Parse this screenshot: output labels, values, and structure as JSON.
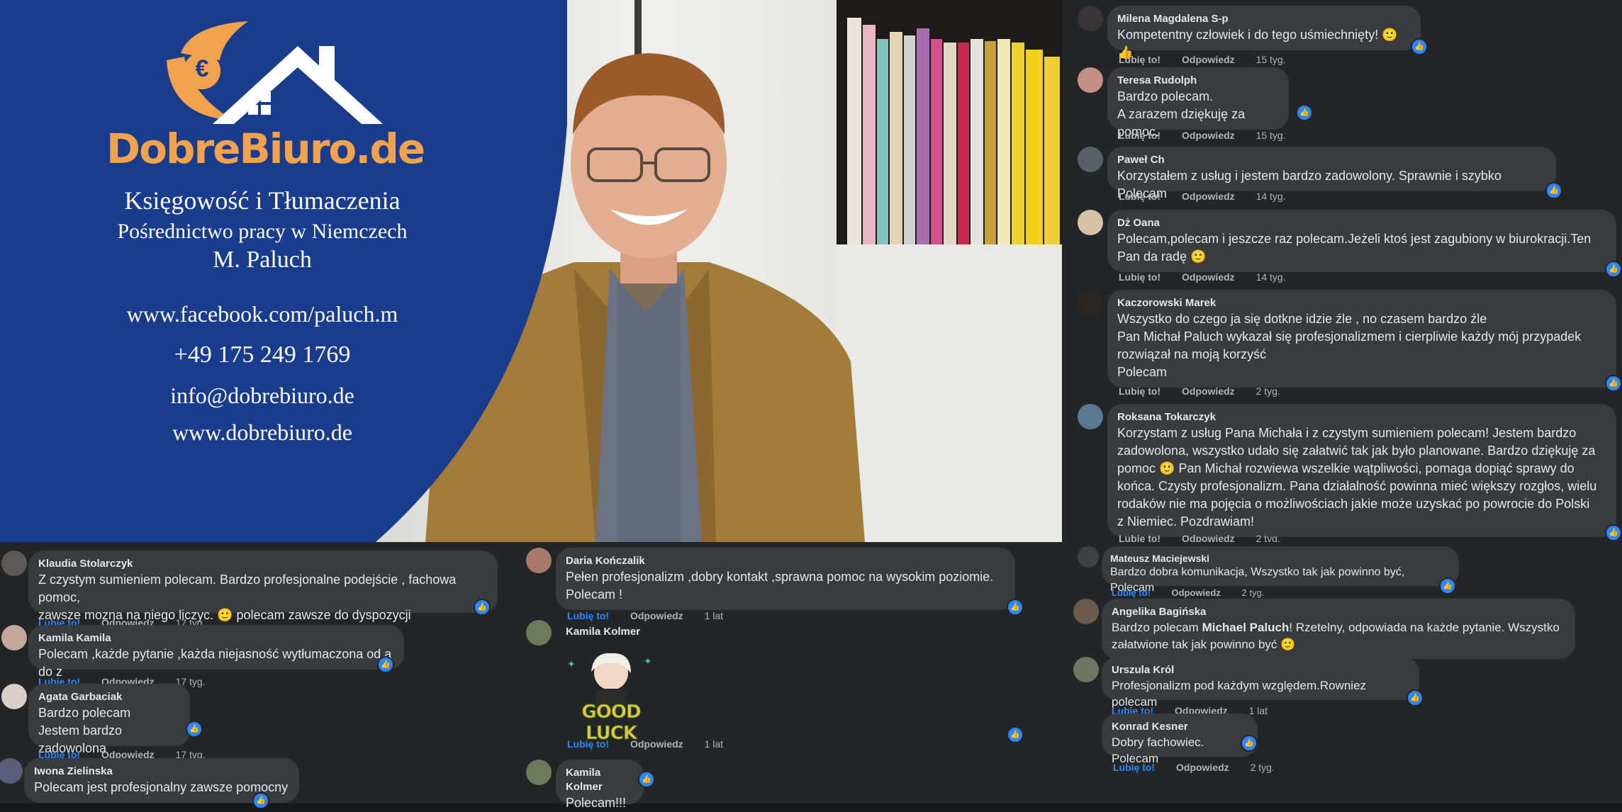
{
  "banner": {
    "brand": "DobreBiuro.de",
    "euro_symbol": "€",
    "line1": "Księgowość i Tłumaczenia",
    "line2": "Pośrednictwo pracy w Niemczech",
    "line3": "M. Paluch",
    "facebook": "www.facebook.com/paluch.m",
    "phone": "+49 175 249 1769",
    "email": "info@dobrebiuro.de",
    "website": "www.dobrebiuro.de",
    "colors": {
      "card_blue": "#1a3c8c",
      "brand_orange": "#f0a24d"
    }
  },
  "actions": {
    "like": "Lubię to!",
    "reply": "Odpowiedz"
  },
  "thumb": "👍",
  "comments_right": [
    {
      "name": "Milena Magdalena S-p",
      "text": "Kompetentny człowiek i do tego uśmiechnięty! 🙂👍",
      "time": "15 tyg."
    },
    {
      "name": "Teresa Rudolph",
      "text": "Bardzo polecam.",
      "text2": "A zarazem dziękuję za pomoc.",
      "time": "15 tyg."
    },
    {
      "name": "Paweł Ch",
      "text": "Korzystałem z usług i jestem bardzo zadowolony. Sprawnie i szybko Polecam",
      "time": "14 tyg."
    },
    {
      "name": "Dż Oana",
      "text": "Polecam,polecam i jeszcze raz polecam.Jeżeli ktoś jest zagubiony w biurokracji.Ten",
      "text2": "Pan da radę 🙂",
      "time": "14 tyg."
    },
    {
      "name": "Kaczorowski Marek",
      "text": "Wszystko do czego ja się dotkne idzie źle , no czasem bardzo źle",
      "text2": "Pan Michał Paluch wykazał się profesjonalizmem i cierpliwie każdy mój przypadek",
      "text3": "rozwiązał na moją korzyść",
      "text4": "Polecam",
      "time": "2 tyg."
    },
    {
      "name": "Roksana Tokarczyk",
      "text": "Korzystam z usług Pana Michała i z czystym sumieniem polecam! Jestem bardzo",
      "text2": "zadowolona, wszystko udało się załatwić tak jak było planowane. Bardzo dziękuję za",
      "text3": "pomoc 🙂 Pan Michał rozwiewa wszelkie wątpliwości, pomaga dopiąć sprawy do",
      "text4": "końca. Czysty profesjonalizm. Pana działalność powinna mieć większy rozgłos, wielu",
      "text5": "rodaków nie ma pojęcia o możliwościach jakie może uzyskać po powrocie do Polski",
      "text6": "z Niemiec. Pozdrawiam!",
      "time": "2 tyg."
    }
  ],
  "comments_bottom_left": [
    {
      "name": "Klaudia Stolarczyk",
      "text": "Z czystym sumieniem polecam. Bardzo profesjonalne podejście , fachowa pomoc,",
      "text2": "zawsze mozna na niego liczyc. 🙂 polecam zawsze do dyspozycji",
      "time": "17 tyg."
    },
    {
      "name": "Kamila Kamila",
      "text": "Polecam ,każde pytanie ,każda niejasność wytłumaczona od a do z",
      "time": "17 tyg."
    },
    {
      "name": "Agata Garbaciak",
      "text": "Bardzo polecam",
      "text2": "Jestem bardzo zadowolona",
      "time": "17 tyg."
    },
    {
      "name": "Iwona Zielinska",
      "text": "Polecam jest profesjonalny zawsze pomocny"
    }
  ],
  "comments_bottom_mid": [
    {
      "name": "Daria Kończalik",
      "text": "Pełen profesjonalizm ,dobry kontakt ,sprawna pomoc na wysokim poziomie.",
      "text2": "Polecam !",
      "time": "1 lat"
    },
    {
      "name": "Kamila Kolmer",
      "sticker": "GOOD LUCK",
      "time": "1 lat"
    },
    {
      "name": "Kamila Kolmer",
      "text": "Polecam!!!"
    }
  ],
  "comments_bottom_right": [
    {
      "name": "Mateusz Maciejewski",
      "text": "Bardzo dobra komunikacja, Wszystko tak jak powinno być, Polecam",
      "time": "2 tyg."
    },
    {
      "name": "Angelika Bagińska",
      "text_pre": "Bardzo polecam ",
      "text_bold": "Michael Paluch",
      "text_post": "! Rzetelny, odpowiada na każde pytanie. Wszystko",
      "text2": "załatwione tak jak powinno być 🙂"
    },
    {
      "name": "Urszula Król",
      "text": "Profesjonalizm pod każdym względem.Rowniez polecam",
      "time": "1 lat"
    },
    {
      "name": "Konrad Kesner",
      "text": "Dobry fachowiec. Polecam",
      "time": "2 tyg."
    }
  ]
}
